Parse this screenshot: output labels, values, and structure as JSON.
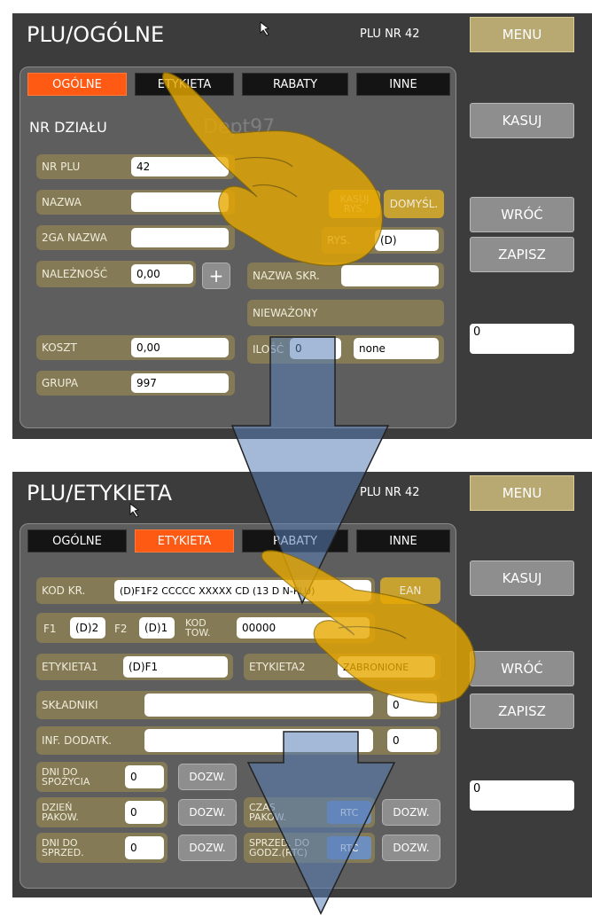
{
  "screen1": {
    "title": "PLU/OGÓLNE",
    "plu_nr": "PLU NR 42",
    "menu": "MENU",
    "tabs": [
      "OGÓLNE",
      "ETYKIETA",
      "RABATY",
      "INNE"
    ],
    "dept_label": "NR DZIAŁU",
    "dept_value": "Dept97",
    "fields": {
      "nr_plu": {
        "label": "NR PLU",
        "value": "42"
      },
      "nazwa": {
        "label": "NAZWA",
        "value": ""
      },
      "nazwa2": {
        "label": "2GA NAZWA",
        "value": ""
      },
      "naleznosc": {
        "label": "NALEŻNOŚĆ",
        "value": "0,00"
      },
      "koszt": {
        "label": "KOSZT",
        "value": "0,00"
      },
      "grupa": {
        "label": "GRUPA",
        "value": "997"
      },
      "kasuj_rys": "KASUJ RYS.",
      "domysl": "DOMYŚL.",
      "rys": {
        "label": "RYS.",
        "value": "(D)"
      },
      "nazwa_skr": {
        "label": "NAZWA SKR.",
        "value": ""
      },
      "niewazony": "NIEWAŻONY",
      "ilosc": {
        "label": "ILOŚĆ",
        "value": "0",
        "unit": "none"
      }
    },
    "plus": "+",
    "side": {
      "kasuj": "KASUJ",
      "wroc": "WRÓĆ",
      "zapisz": "ZAPISZ",
      "value": "0"
    }
  },
  "screen2": {
    "title": "PLU/ETYKIETA",
    "plu_nr": "PLU NR 42",
    "menu": "MENU",
    "tabs": [
      "OGÓLNE",
      "ETYKIETA",
      "RABATY",
      "INNE"
    ],
    "fields": {
      "kod_kr": {
        "label": "KOD KR.",
        "value": "(D)F1F2 CCCCC XXXXX CD (13 D N-PLU)"
      },
      "ean": "EAN",
      "f1": {
        "label": "F1",
        "value": "(D)2"
      },
      "f2": {
        "label": "F2",
        "value": "(D)1"
      },
      "kod_tow": {
        "label": "KOD TOW.",
        "value": "00000"
      },
      "etykieta1": {
        "label": "ETYKIETA1",
        "value": "(D)F1"
      },
      "etykieta2": {
        "label": "ETYKIETA2",
        "value": "ZABRONIONE"
      },
      "skladniki": {
        "label": "SKŁADNIKI",
        "value": "",
        "num": "0"
      },
      "inf_dodatk": {
        "label": "INF. DODATK.",
        "value": "",
        "num": "0"
      },
      "dni_spozycia": {
        "label": "DNI DO SPOŻYCIA",
        "value": "0"
      },
      "dzien_pakow": {
        "label": "DZIEŃ PAKOW.",
        "value": "0"
      },
      "dni_sprzed": {
        "label": "DNI DO SPRZED.",
        "value": "0"
      },
      "czas_pakow": {
        "label": "CZAS PAKOW.",
        "rtc": "RTC"
      },
      "sprzed_godz": {
        "label": "SPRZED. DO GODZ.(RTC)",
        "rtc": "RTC"
      },
      "dozw": "DOZW."
    },
    "side": {
      "kasuj": "KASUJ",
      "wroc": "WRÓĆ",
      "zapisz": "ZAPISZ",
      "value": "0"
    }
  }
}
